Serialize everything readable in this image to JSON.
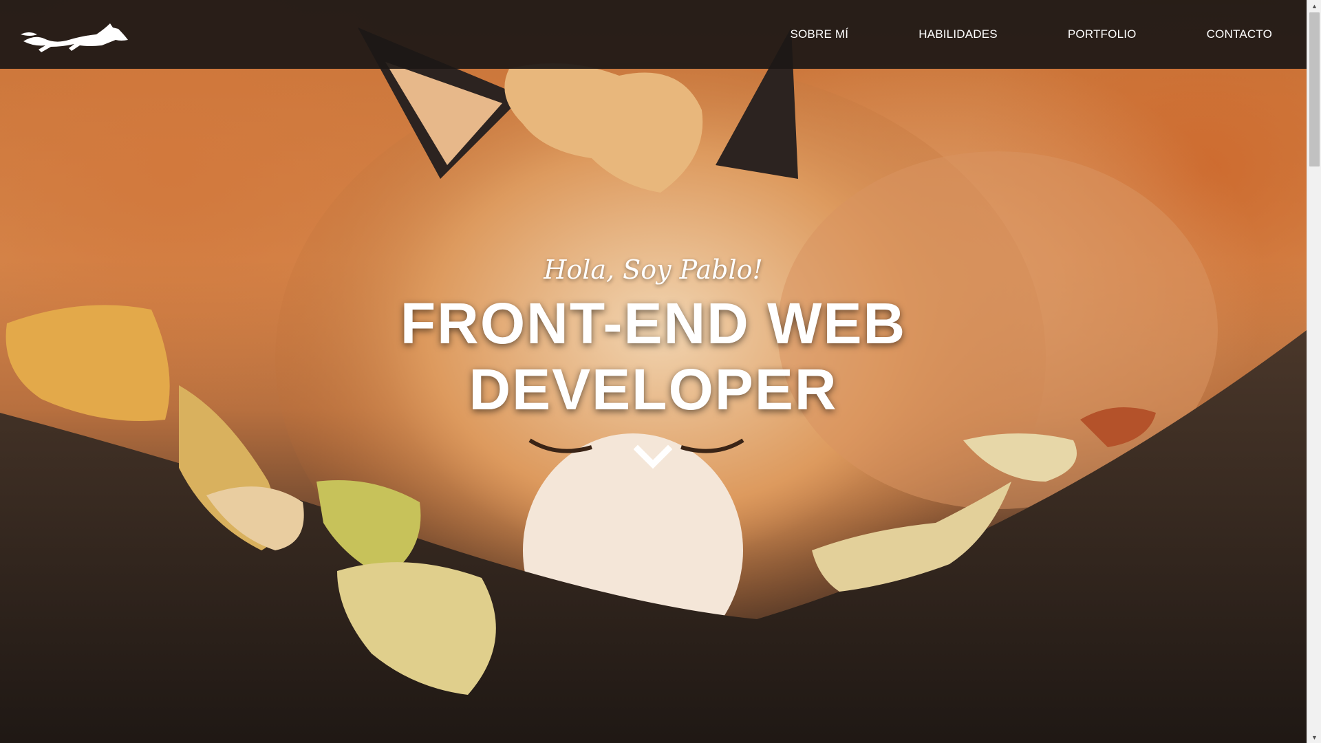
{
  "navbar": {
    "logo_icon": "fox-running-icon",
    "items": [
      {
        "label": "SOBRE MÍ"
      },
      {
        "label": "HABILIDADES"
      },
      {
        "label": "PORTFOLIO"
      },
      {
        "label": "CONTACTO"
      }
    ]
  },
  "hero": {
    "greeting": "Hola, Soy Pablo!",
    "headline_line1": "FRONT-END WEB",
    "headline_line2": "DEVELOPER",
    "scroll_icon": "chevron-down-icon"
  },
  "scrollbar": {
    "up_arrow": "▲",
    "down_arrow": "▼"
  },
  "colors": {
    "navbar_bg": "#1c1816",
    "text": "#ffffff",
    "fox_orange": "#d5864b"
  }
}
